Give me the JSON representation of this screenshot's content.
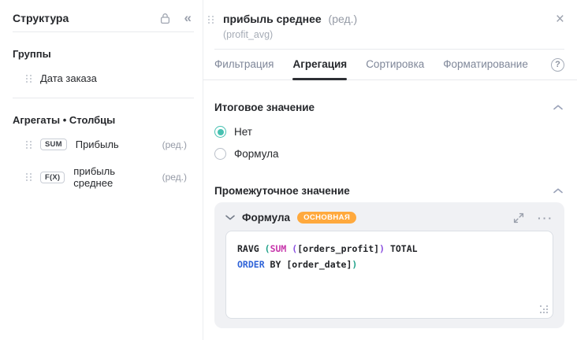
{
  "colors": {
    "accent_teal": "#47c1b1",
    "badge_orange": "#ffa93d",
    "code_text": "#222428",
    "code_keyword": "#2f63d8",
    "code_function": "#c736ab",
    "code_paren_outer": "#1ea189",
    "code_paren_inner": "#8a4fdf"
  },
  "sidebar": {
    "title": "Структура",
    "collapse_glyph": "«",
    "groups_header": "Группы",
    "group_items": [
      {
        "label": "Дата заказа"
      }
    ],
    "aggregates_header": "Агрегаты • Столбцы",
    "aggregate_items": [
      {
        "badge": "SUM",
        "label": "Прибыль",
        "edit_hint": "(ред.)"
      },
      {
        "badge": "F(X)",
        "label": "прибыль среднее",
        "edit_hint": "(ред.)"
      }
    ]
  },
  "panel": {
    "title": "прибыль среднее",
    "title_edit_hint": "(ред.)",
    "field_id": "(profit_avg)",
    "close_glyph": "×",
    "help_glyph": "?",
    "tabs": [
      {
        "label": "Фильтрация",
        "active": false
      },
      {
        "label": "Агрегация",
        "active": true
      },
      {
        "label": "Сортировка",
        "active": false
      },
      {
        "label": "Форматирование",
        "active": false
      }
    ],
    "total_section": {
      "title": "Итоговое значение",
      "options": [
        {
          "label": "Нет",
          "selected": true
        },
        {
          "label": "Формула",
          "selected": false
        }
      ]
    },
    "intermediate_section": {
      "title": "Промежуточное значение",
      "formula_card": {
        "title": "Формула",
        "badge": "ОСНОВНАЯ",
        "menu_glyph": "···",
        "code_text": "RAVG (SUM ([orders_profit]) TOTAL\nORDER BY [order_date])",
        "code_lines": [
          {
            "tokens": [
              {
                "t": "RAVG ",
                "c": "plain"
              },
              {
                "t": "(",
                "c": "p1"
              },
              {
                "t": "SUM",
                "c": "fn"
              },
              {
                "t": " ",
                "c": "plain"
              },
              {
                "t": "(",
                "c": "p2"
              },
              {
                "t": "[orders_profit]",
                "c": "plain"
              },
              {
                "t": ")",
                "c": "p2"
              },
              {
                "t": " TOTAL",
                "c": "plain"
              }
            ]
          },
          {
            "tokens": [
              {
                "t": "ORDER",
                "c": "kw"
              },
              {
                "t": " BY [order_date]",
                "c": "plain"
              },
              {
                "t": ")",
                "c": "p1"
              }
            ]
          }
        ]
      }
    }
  }
}
